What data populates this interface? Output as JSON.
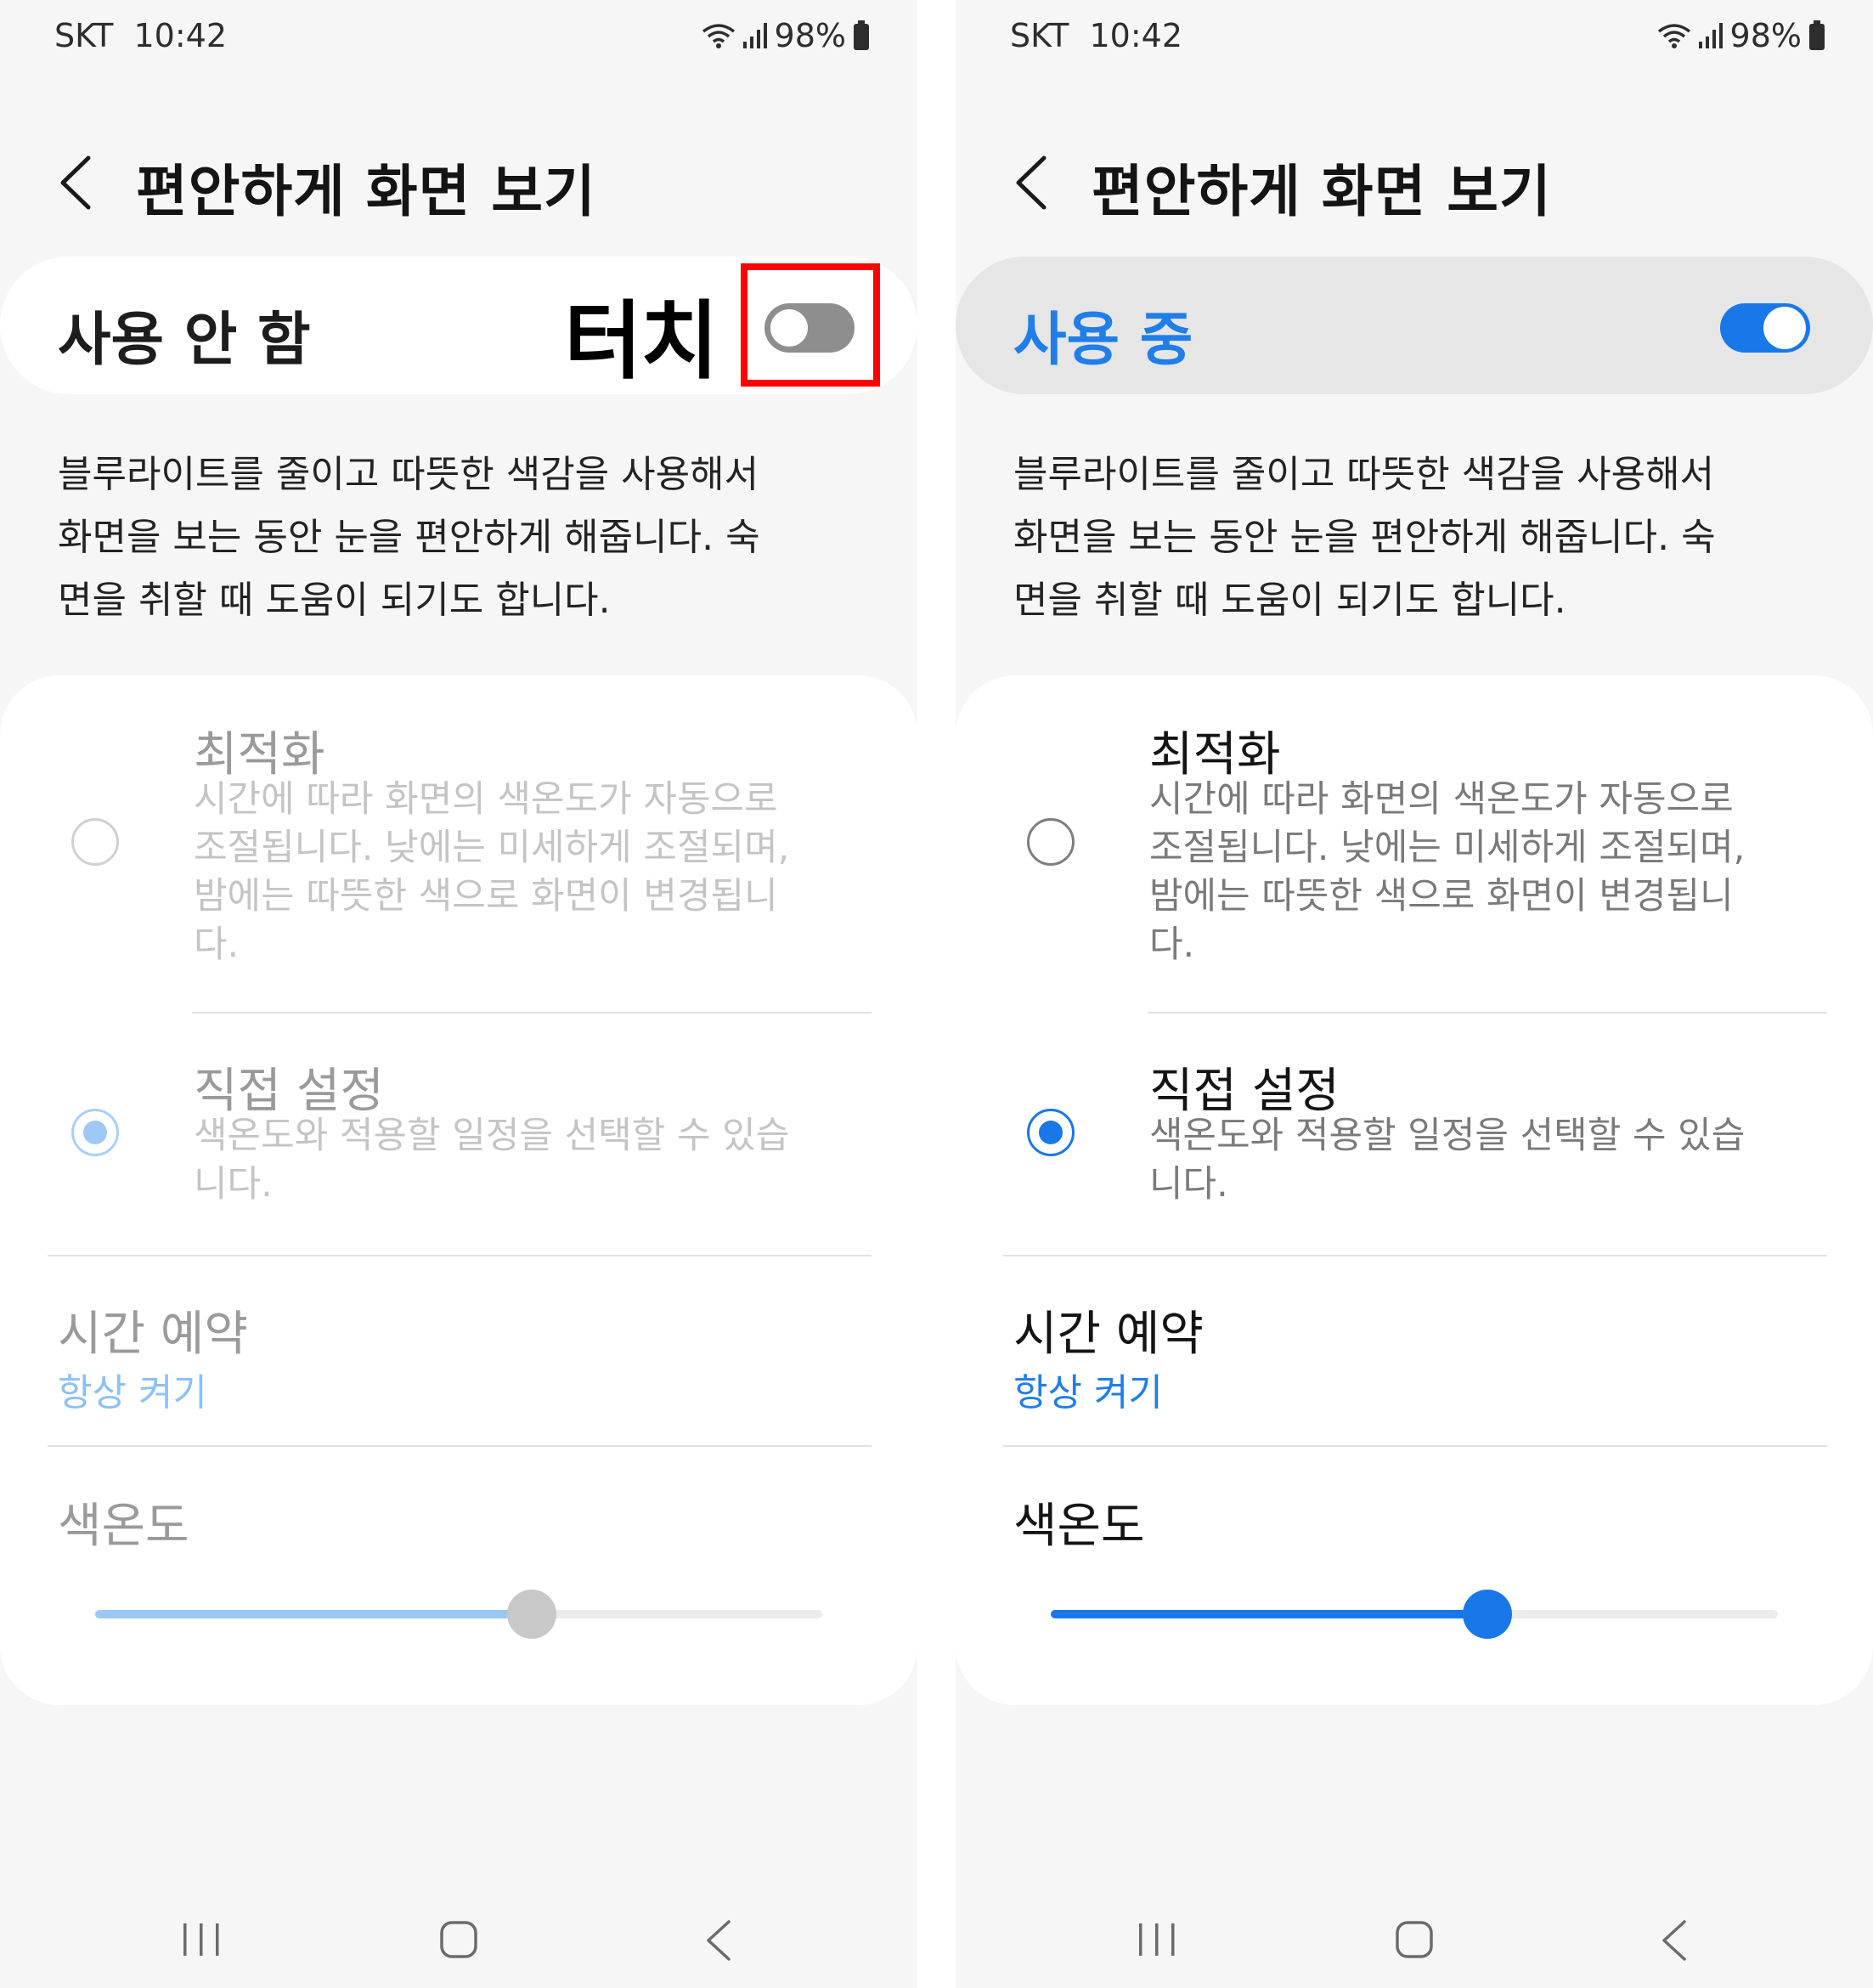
{
  "screens": {
    "left": {
      "status": {
        "carrier": "SKT",
        "time": "10:42",
        "battery": "98%"
      },
      "title": "편안하게 화면 보기",
      "master": {
        "label": "사용 안 함",
        "enabled": false
      },
      "annotation": "터치",
      "description_lines": [
        "블루라이트를 줄이고 따뜻한 색감을 사용해서",
        "화면을 보는 동안 눈을 편안하게 해줍니다. 숙",
        "면을 취할 때 도움이 되기도 합니다."
      ],
      "options": {
        "optimize": {
          "title": "최적화",
          "lines": [
            "시간에 따라 화면의 색온도가 자동으로",
            "조절됩니다. 낮에는 미세하게 조절되며,",
            "밤에는 따뜻한 색으로 화면이 변경됩니",
            "다."
          ],
          "selected": false
        },
        "custom": {
          "title": "직접 설정",
          "lines": [
            "색온도와 적용할 일정을 선택할 수 있습",
            "니다."
          ],
          "selected": true
        }
      },
      "schedule": {
        "title": "시간 예약",
        "value": "항상 켜기"
      },
      "color_temp": {
        "title": "색온도",
        "level": 0.6
      }
    },
    "right": {
      "status": {
        "carrier": "SKT",
        "time": "10:42",
        "battery": "98%"
      },
      "title": "편안하게 화면 보기",
      "master": {
        "label": "사용 중",
        "enabled": true
      },
      "description_lines": [
        "블루라이트를 줄이고 따뜻한 색감을 사용해서",
        "화면을 보는 동안 눈을 편안하게 해줍니다. 숙",
        "면을 취할 때 도움이 되기도 합니다."
      ],
      "options": {
        "optimize": {
          "title": "최적화",
          "lines": [
            "시간에 따라 화면의 색온도가 자동으로",
            "조절됩니다. 낮에는 미세하게 조절되며,",
            "밤에는 따뜻한 색으로 화면이 변경됩니",
            "다."
          ],
          "selected": false
        },
        "custom": {
          "title": "직접 설정",
          "lines": [
            "색온도와 적용할 일정을 선택할 수 있습",
            "니다."
          ],
          "selected": true
        }
      },
      "schedule": {
        "title": "시간 예약",
        "value": "항상 켜기"
      },
      "color_temp": {
        "title": "색온도",
        "level": 0.6
      }
    }
  },
  "colors": {
    "accent": "#1878e8",
    "highlight": "#ff0000",
    "disabled_accent": "#9ac8f4"
  },
  "icons": [
    "wifi-icon",
    "signal-icon",
    "battery-icon",
    "back-arrow-icon",
    "nav-recent-icon",
    "nav-home-icon",
    "nav-back-icon"
  ]
}
